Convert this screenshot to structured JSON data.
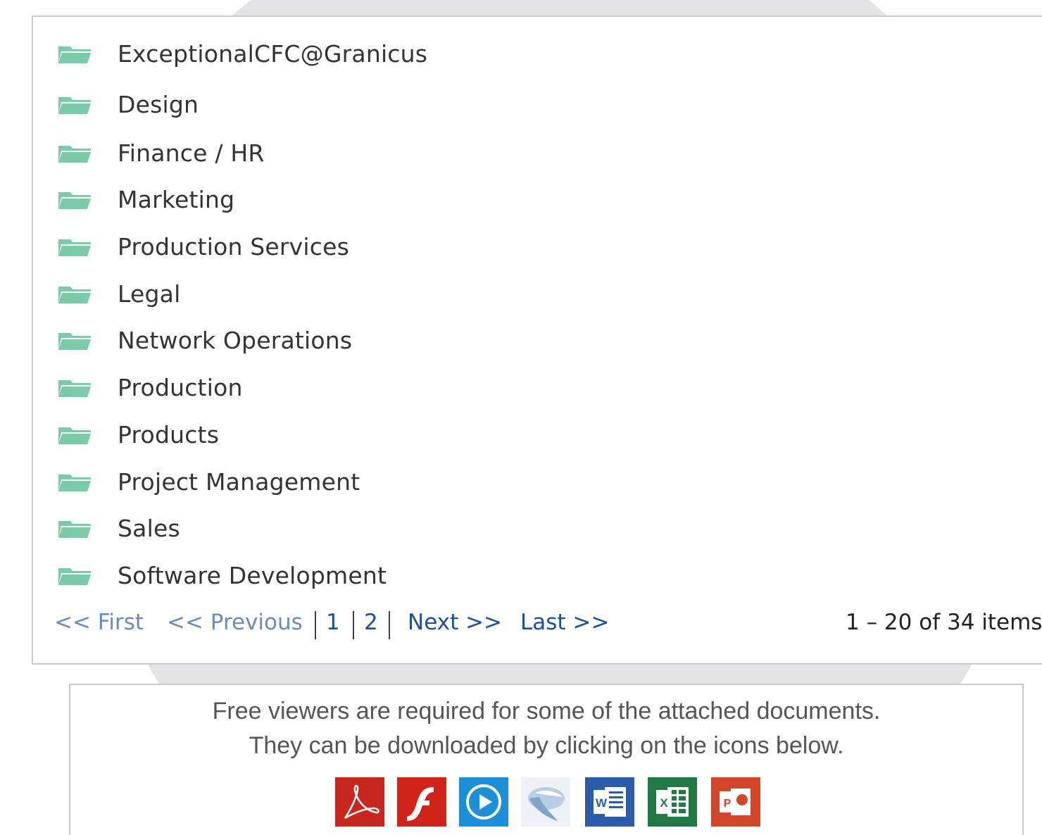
{
  "folders": [
    {
      "label": "ExceptionalCFC@Granicus"
    },
    {
      "label": "Design"
    },
    {
      "label": "Finance / HR"
    },
    {
      "label": "Marketing"
    },
    {
      "label": "Production Services"
    },
    {
      "label": "Legal"
    },
    {
      "label": "Network Operations"
    },
    {
      "label": "Production"
    },
    {
      "label": "Products"
    },
    {
      "label": "Project Management"
    },
    {
      "label": "Sales"
    },
    {
      "label": "Software Development"
    }
  ],
  "pager": {
    "first": "<< First",
    "previous": "<< Previous",
    "pages": [
      "1",
      "2"
    ],
    "next": "Next >>",
    "last": "Last >>",
    "count": "1 – 20 of 34 items"
  },
  "viewers": {
    "line1": "Free viewers are required for some of the attached documents.",
    "line2": "They can be downloaded by clicking on the icons below.",
    "icons": [
      "adobe-reader-icon",
      "flash-player-icon",
      "windows-media-player-icon",
      "silverlight-icon",
      "word-viewer-icon",
      "excel-viewer-icon",
      "powerpoint-viewer-icon"
    ]
  },
  "colors": {
    "folder": "#7ccba8",
    "link": "#1d4f9e",
    "link_disabled": "#6c8bbd",
    "text": "#333333",
    "border": "#c9cacc"
  }
}
